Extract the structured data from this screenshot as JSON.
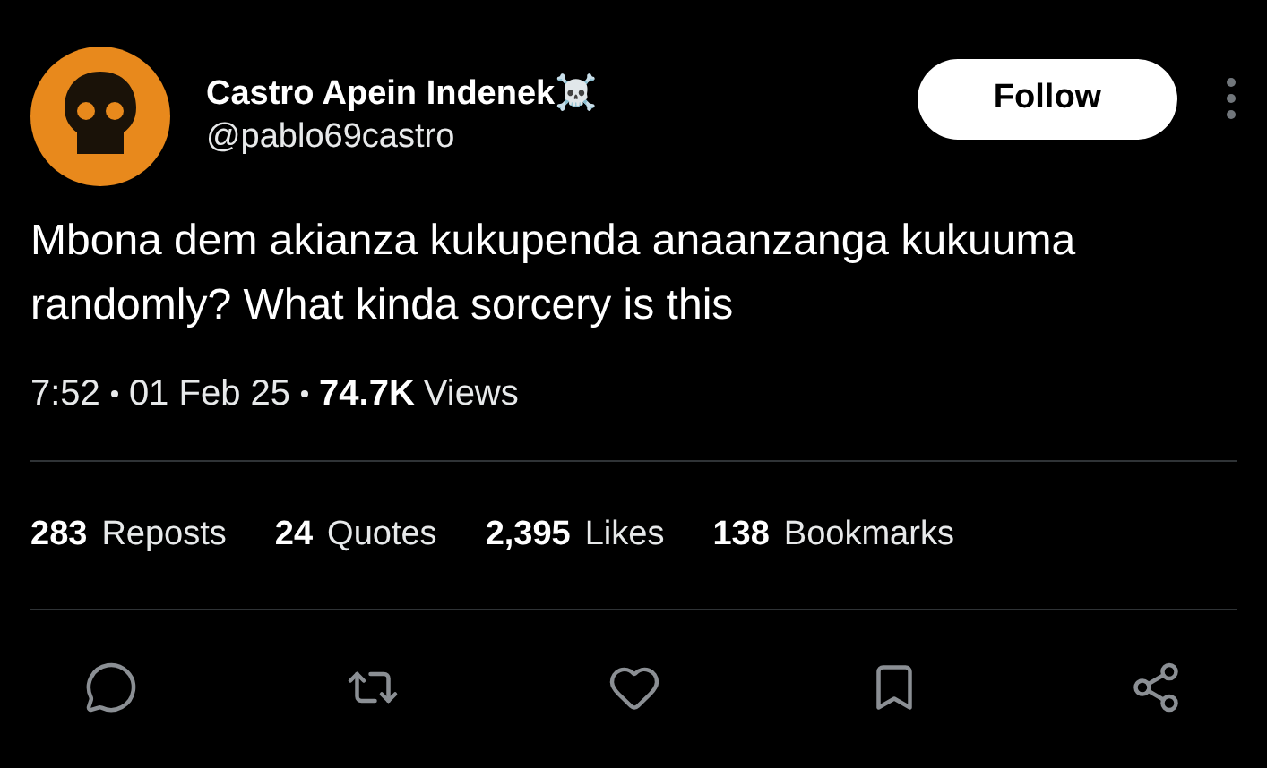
{
  "author": {
    "name": "Castro Apein Indenek☠️",
    "handle": "@pablo69castro"
  },
  "follow_button": "Follow",
  "text": "Mbona dem akianza kukupenda anaanzanga kukuuma randomly? What kinda sorcery is this",
  "meta": {
    "time": "7:52",
    "date": "01 Feb 25",
    "views_count": "74.7K",
    "views_label": "Views"
  },
  "stats": [
    {
      "count": "283",
      "label": "Reposts"
    },
    {
      "count": "24",
      "label": "Quotes"
    },
    {
      "count": "2,395",
      "label": "Likes"
    },
    {
      "count": "138",
      "label": "Bookmarks"
    }
  ],
  "actions": [
    {
      "kind": "reply"
    },
    {
      "kind": "repost"
    },
    {
      "kind": "like"
    },
    {
      "kind": "bookmark"
    },
    {
      "kind": "share"
    }
  ]
}
